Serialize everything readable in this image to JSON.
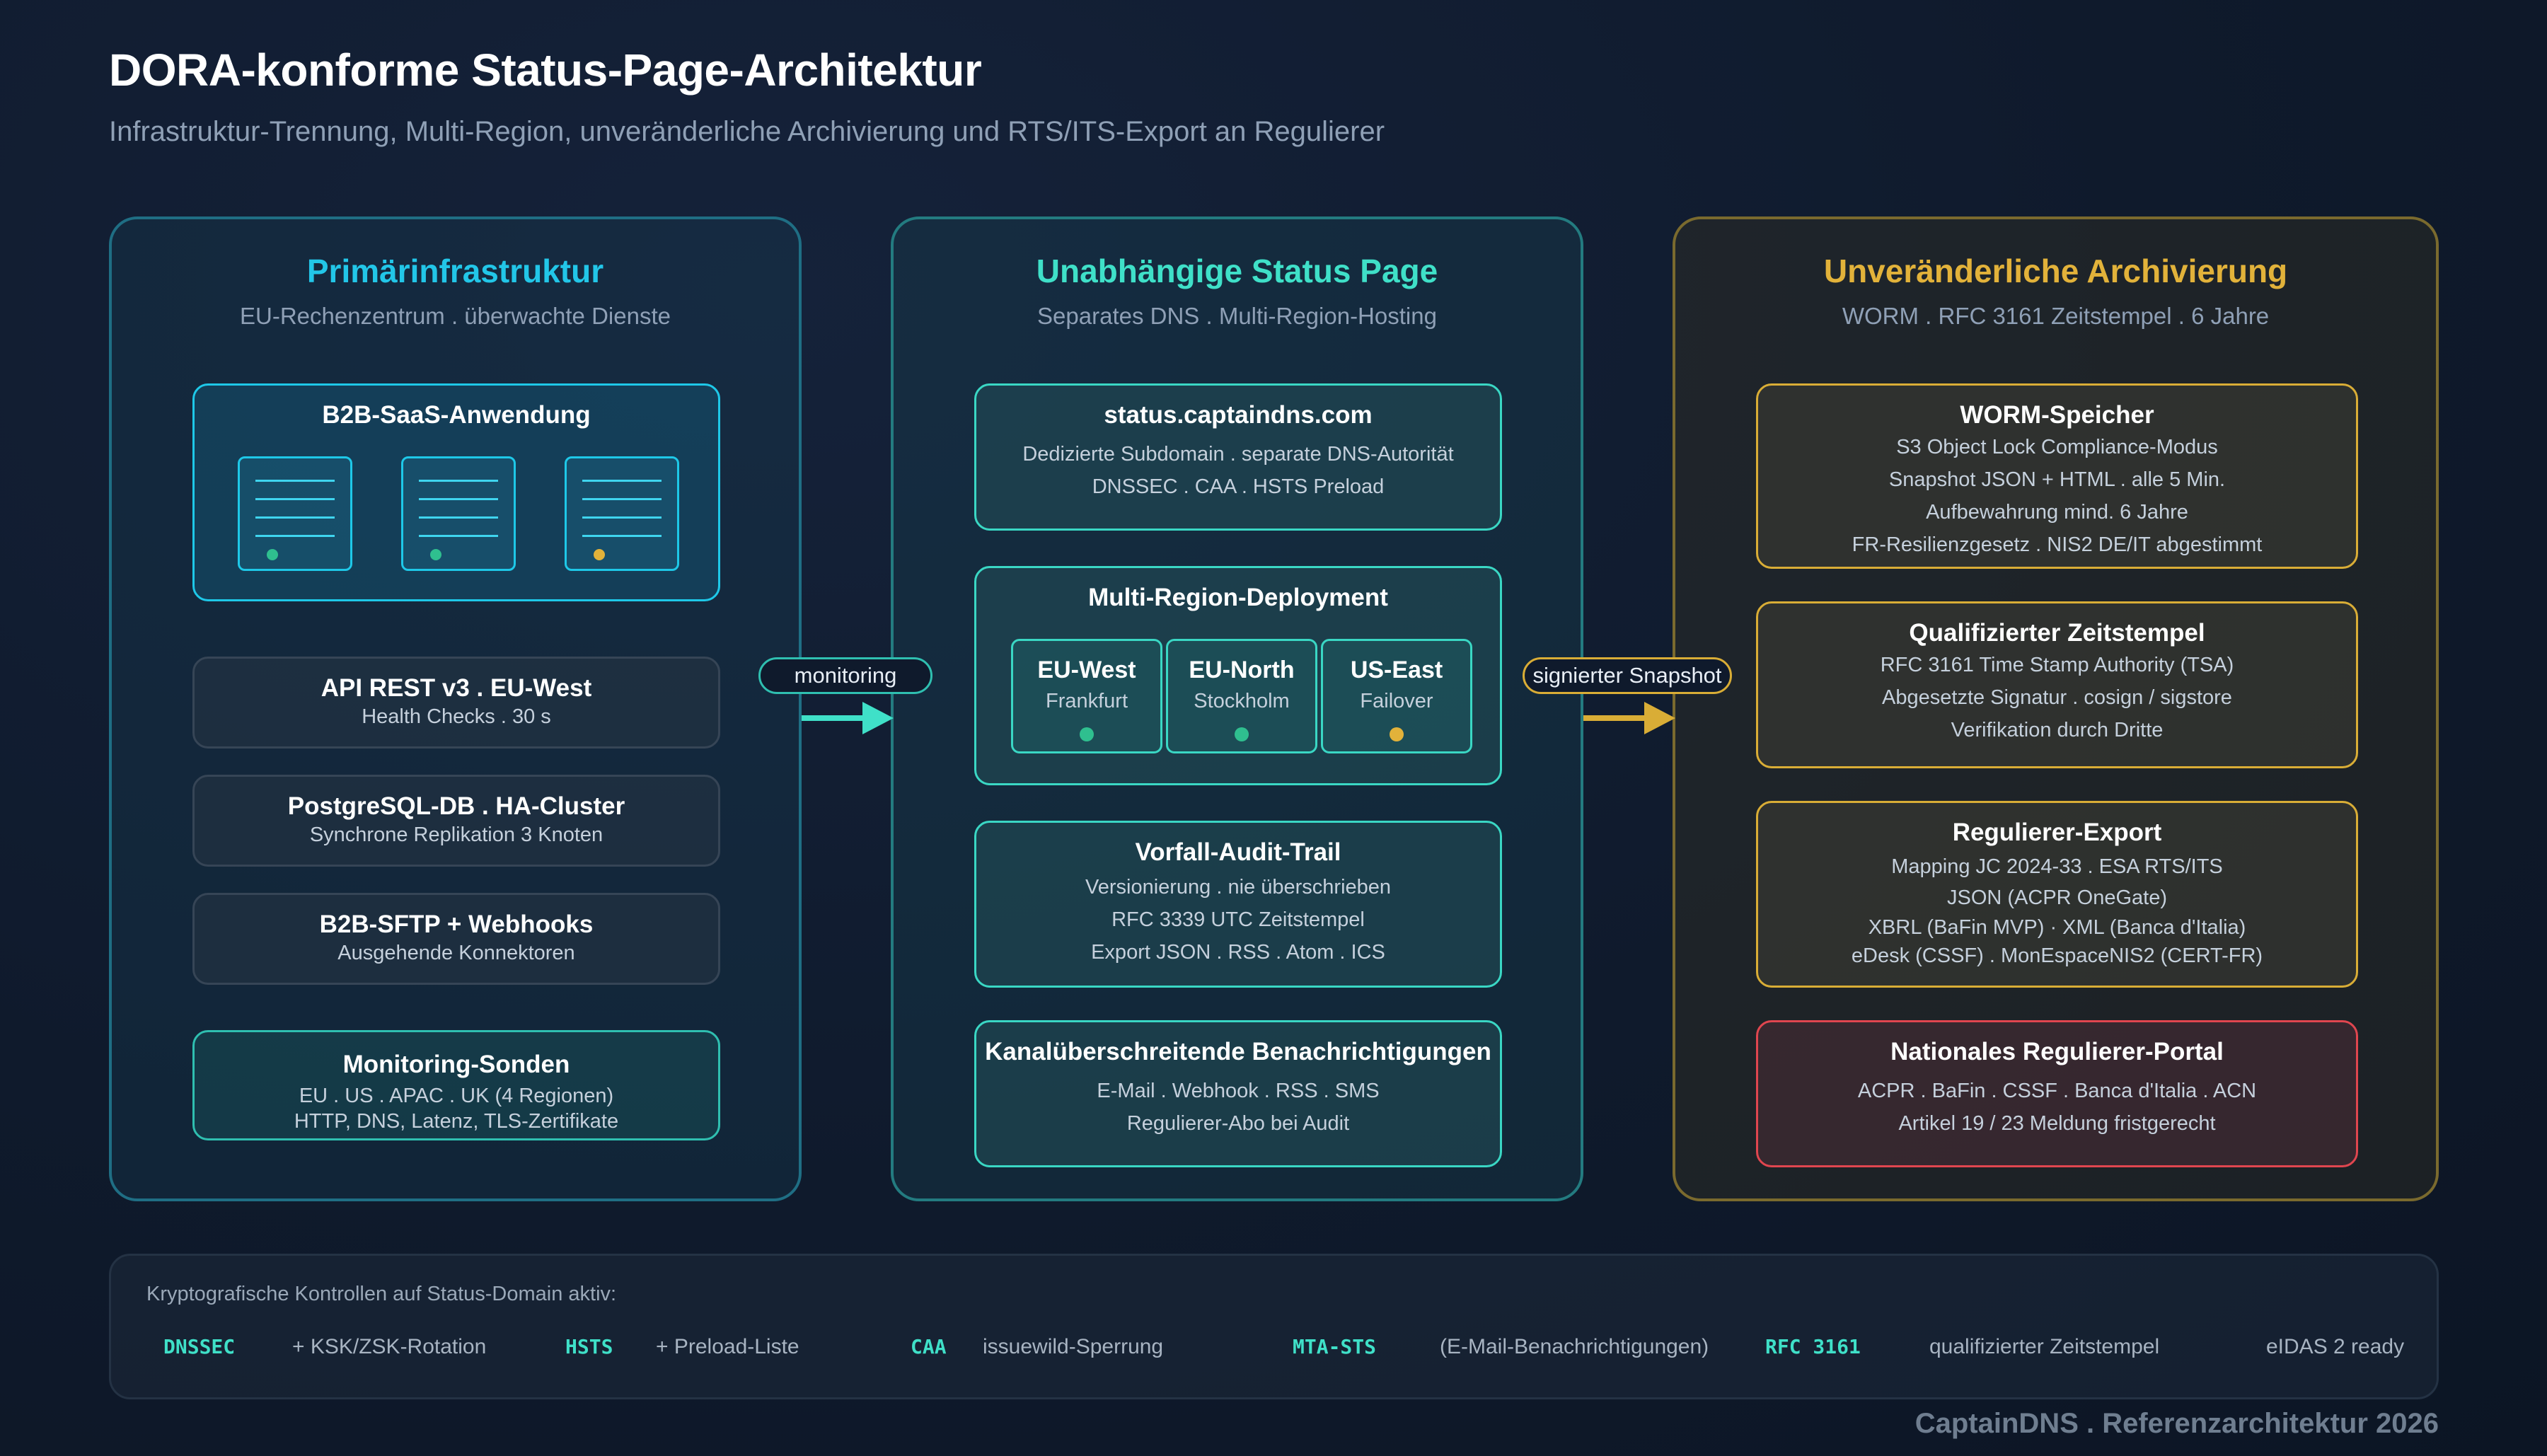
{
  "header": {
    "title": "DORA-konforme Status-Page-Architektur",
    "subtitle": "Infrastruktur-Trennung, Multi-Region, unveränderliche Archivierung und RTS/ITS-Export an Regulierer"
  },
  "columns": {
    "primary": {
      "title": "Primärinfrastruktur",
      "subtitle": "EU-Rechenzentrum . überwachte Dienste",
      "app_box": {
        "title": "B2B-SaaS-Anwendung"
      },
      "boxes": [
        {
          "title": "API REST v3 . EU-West",
          "lines": [
            "Health Checks . 30 s"
          ]
        },
        {
          "title": "PostgreSQL-DB . HA-Cluster",
          "lines": [
            "Synchrone Replikation 3 Knoten"
          ]
        },
        {
          "title": "B2B-SFTP + Webhooks",
          "lines": [
            "Ausgehende Konnektoren"
          ]
        }
      ],
      "probes": {
        "title": "Monitoring-Sonden",
        "lines": [
          "EU . US . APAC . UK (4 Regionen)",
          "HTTP, DNS, Latenz, TLS-Zertifikate"
        ]
      }
    },
    "status": {
      "title": "Unabhängige Status Page",
      "subtitle": "Separates DNS . Multi-Region-Hosting",
      "domain_box": {
        "title": "status.captaindns.com",
        "lines": [
          "Dedizierte Subdomain . separate DNS-Autorität",
          "DNSSEC . CAA . HSTS Preload"
        ]
      },
      "multi_region": {
        "title": "Multi-Region-Deployment",
        "regions": [
          {
            "name": "EU-West",
            "city": "Frankfurt"
          },
          {
            "name": "EU-North",
            "city": "Stockholm"
          },
          {
            "name": "US-East",
            "city": "Failover"
          }
        ]
      },
      "audit_box": {
        "title": "Vorfall-Audit-Trail",
        "lines": [
          "Versionierung . nie überschrieben",
          "RFC 3339 UTC Zeitstempel",
          "Export JSON . RSS . Atom . ICS"
        ]
      },
      "notify_box": {
        "title": "Kanalüberschreitende Benachrichtigungen",
        "lines": [
          "E-Mail . Webhook . RSS . SMS",
          "Regulierer-Abo bei Audit"
        ]
      }
    },
    "archive": {
      "title": "Unveränderliche Archivierung",
      "subtitle": "WORM . RFC 3161 Zeitstempel . 6 Jahre",
      "worm_box": {
        "title": "WORM-Speicher",
        "lines": [
          "S3 Object Lock Compliance-Modus",
          "Snapshot JSON + HTML . alle 5 Min.",
          "Aufbewahrung mind. 6 Jahre",
          "FR-Resilienzgesetz . NIS2 DE/IT abgestimmt"
        ]
      },
      "tsa_box": {
        "title": "Qualifizierter Zeitstempel",
        "lines": [
          "RFC 3161 Time Stamp Authority (TSA)",
          "Abgesetzte Signatur . cosign / sigstore",
          "Verifikation durch Dritte"
        ]
      },
      "export_box": {
        "title": "Regulierer-Export",
        "lines": [
          "Mapping JC 2024-33 . ESA RTS/ITS",
          "JSON (ACPR OneGate)",
          "XBRL (BaFin MVP) · XML (Banca d'Italia)",
          "eDesk (CSSF) . MonEspaceNIS2 (CERT-FR)"
        ]
      },
      "portal_box": {
        "title": "Nationales Regulierer-Portal",
        "lines": [
          "ACPR . BaFin . CSSF . Banca d'Italia . ACN",
          "Artikel 19 / 23 Meldung fristgerecht"
        ]
      }
    }
  },
  "connectors": {
    "monitoring": "monitoring",
    "snapshot": "signierter Snapshot"
  },
  "footer": {
    "heading": "Kryptografische Kontrollen auf Status-Domain aktiv:",
    "items": [
      {
        "code": "DNSSEC",
        "text": "+ KSK/ZSK-Rotation"
      },
      {
        "code": "HSTS",
        "text": "+ Preload-Liste"
      },
      {
        "code": "CAA",
        "text": "issuewild-Sperrung"
      },
      {
        "code": "MTA-STS",
        "text": "(E-Mail-Benachrichtigungen)"
      },
      {
        "code": "RFC 3161",
        "text": "qualifizierter Zeitstempel"
      }
    ],
    "eidas": "eIDAS 2 ready"
  },
  "credit": "CaptainDNS . Referenzarchitektur 2026",
  "colors": {
    "cyan": "#1ec8e8",
    "teal": "#3ad7c4",
    "gold": "#d9ad36",
    "red": "#e0464f",
    "status_green": "#2fbf8f",
    "status_yellow": "#e2b23a"
  }
}
